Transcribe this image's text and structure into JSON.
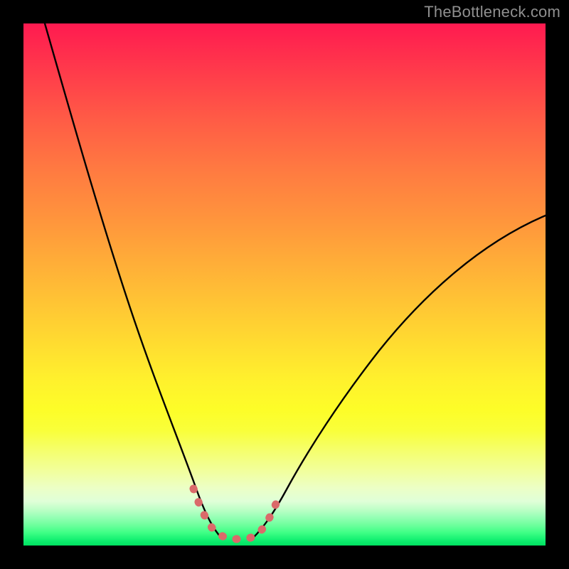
{
  "watermark": "TheBottleneck.com",
  "chart_data": {
    "type": "line",
    "title": "",
    "xlabel": "",
    "ylabel": "",
    "xlim": [
      0,
      100
    ],
    "ylim": [
      0,
      100
    ],
    "grid": false,
    "legend": false,
    "background": "rainbow-gradient",
    "series": [
      {
        "name": "left-curve",
        "stroke": "#000000",
        "x": [
          4,
          8,
          12,
          16,
          20,
          24,
          28,
          30,
          32,
          33.5,
          35,
          36.5,
          38
        ],
        "y": [
          100,
          80,
          62,
          47,
          35,
          25,
          17,
          13,
          9,
          6,
          4,
          2.5,
          1.5
        ]
      },
      {
        "name": "right-curve",
        "stroke": "#000000",
        "x": [
          44,
          46,
          48,
          50,
          54,
          60,
          66,
          74,
          82,
          90,
          100
        ],
        "y": [
          1.5,
          2.5,
          4,
          6,
          11,
          19,
          27,
          37,
          46,
          54,
          63
        ]
      },
      {
        "name": "valley-marker",
        "stroke": "#da6a6a",
        "x": [
          32.5,
          33.5,
          34.5,
          36,
          37.5,
          39,
          41,
          43,
          44.5,
          46,
          47,
          48,
          49.5
        ],
        "y": [
          11,
          8,
          5.5,
          3.5,
          2.5,
          2,
          2,
          2,
          2.5,
          3.5,
          5,
          7,
          10
        ]
      }
    ],
    "annotations": []
  }
}
